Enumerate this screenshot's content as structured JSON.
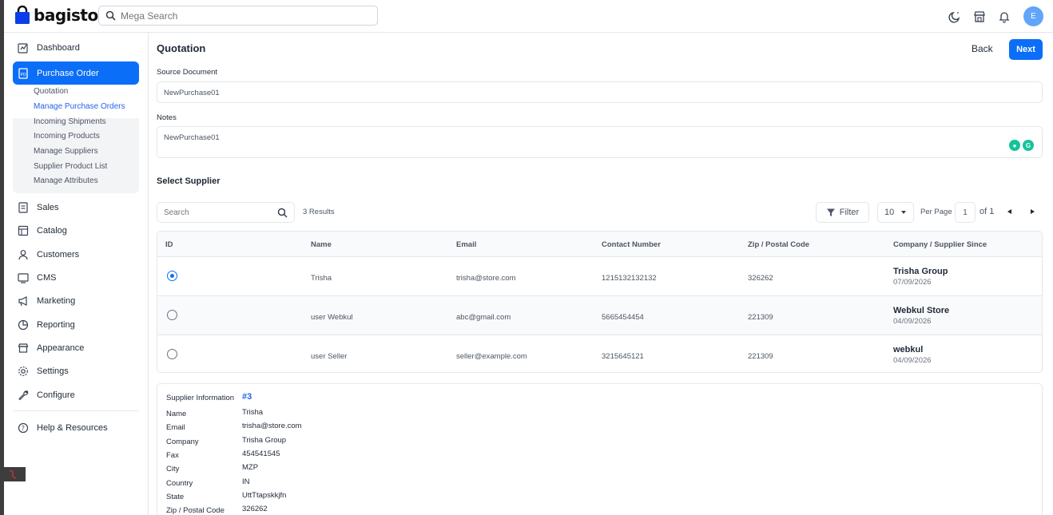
{
  "header": {
    "brand": "bagisto",
    "search_placeholder": "Mega Search",
    "avatar_initial": "E",
    "accent": "#0b6ef8"
  },
  "sidebar": {
    "items": [
      {
        "label": "Dashboard",
        "icon": "dashboard-icon"
      },
      {
        "label": "Purchase Order",
        "icon": "purchase-order-icon",
        "active": true
      },
      {
        "label": "Sales",
        "icon": "sales-icon"
      },
      {
        "label": "Catalog",
        "icon": "catalog-icon"
      },
      {
        "label": "Customers",
        "icon": "customers-icon"
      },
      {
        "label": "CMS",
        "icon": "cms-icon"
      },
      {
        "label": "Marketing",
        "icon": "marketing-icon"
      },
      {
        "label": "Reporting",
        "icon": "reporting-icon"
      },
      {
        "label": "Appearance",
        "icon": "appearance-icon"
      },
      {
        "label": "Settings",
        "icon": "settings-icon"
      },
      {
        "label": "Configure",
        "icon": "configure-icon"
      },
      {
        "label": "Help & Resources",
        "icon": "help-icon"
      }
    ],
    "sub_items": [
      {
        "label": "Quotation"
      },
      {
        "label": "Manage Purchase Orders",
        "current": true
      },
      {
        "label": "Incoming Shipments"
      },
      {
        "label": "Incoming Products"
      },
      {
        "label": "Manage Suppliers"
      },
      {
        "label": "Supplier Product List"
      },
      {
        "label": "Manage Attributes"
      }
    ]
  },
  "page": {
    "title": "Quotation",
    "back_label": "Back",
    "next_label": "Next",
    "source_document_label": "Source Document",
    "source_document_value": "NewPurchase01",
    "notes_label": "Notes",
    "notes_value": "NewPurchase01",
    "select_supplier_title": "Select Supplier"
  },
  "table": {
    "search_placeholder": "Search",
    "results_text": "3 Results",
    "filter_label": "Filter",
    "per_page_value": "10",
    "per_page_label": "Per Page",
    "page_number": "1",
    "of_text": "of 1",
    "columns": [
      "ID",
      "Name",
      "Email",
      "Contact Number",
      "Zip / Postal Code",
      "Company / Supplier Since"
    ],
    "rows": [
      {
        "selected": true,
        "name": "Trisha",
        "email": "trisha@store.com",
        "contact": "1215132132132",
        "zip": "326262",
        "company": "Trisha Group",
        "since": "07/09/2026"
      },
      {
        "selected": false,
        "name": "user Webkul",
        "email": "abc@gmail.com",
        "contact": "5665454454",
        "zip": "221309",
        "company": "Webkul Store",
        "since": "04/09/2026"
      },
      {
        "selected": false,
        "name": "user Seller",
        "email": "seller@example.com",
        "contact": "3215645121",
        "zip": "221309",
        "company": "webkul",
        "since": "04/09/2026"
      }
    ]
  },
  "supplier_info": {
    "title": "Supplier Information",
    "id": "#3",
    "fields": [
      {
        "key": "Name",
        "value": "Trisha"
      },
      {
        "key": "Email",
        "value": "trisha@store.com"
      },
      {
        "key": "Company",
        "value": "Trisha Group"
      },
      {
        "key": "Fax",
        "value": "454541545"
      },
      {
        "key": "City",
        "value": "MZP"
      },
      {
        "key": "Country",
        "value": "IN"
      },
      {
        "key": "State",
        "value": "UttTtapskkjfn"
      },
      {
        "key": "Zip / Postal Code",
        "value": "326262"
      }
    ]
  }
}
